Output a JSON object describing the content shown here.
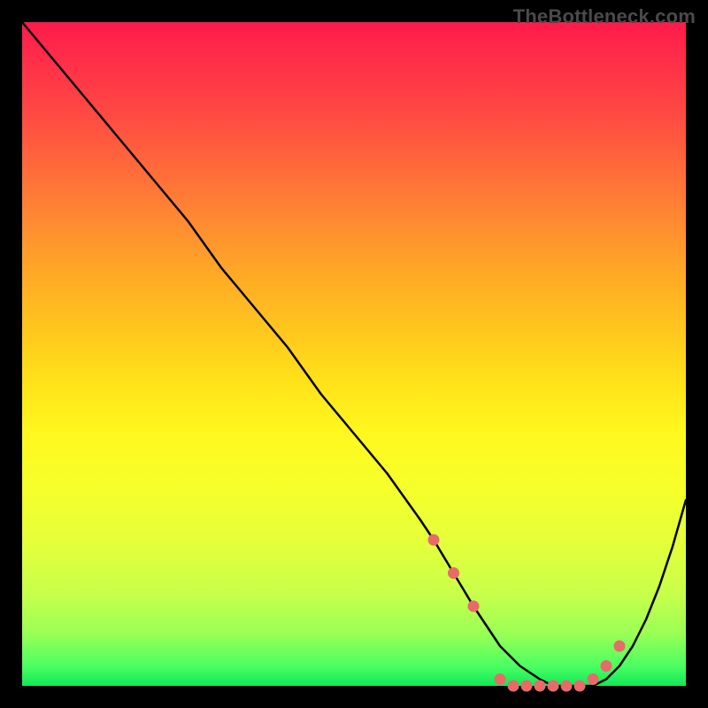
{
  "watermark": "TheBottleneck.com",
  "chart_data": {
    "type": "line",
    "title": "",
    "xlabel": "",
    "ylabel": "",
    "xlim": [
      0,
      100
    ],
    "ylim": [
      0,
      100
    ],
    "grid": false,
    "legend": false,
    "series": [
      {
        "name": "bottleneck-curve",
        "x": [
          0,
          5,
          10,
          15,
          20,
          25,
          30,
          35,
          40,
          45,
          50,
          55,
          60,
          62,
          65,
          68,
          70,
          72,
          75,
          78,
          80,
          82,
          84,
          86,
          88,
          90,
          92,
          94,
          96,
          98,
          100
        ],
        "y": [
          100,
          94,
          88,
          82,
          76,
          70,
          63,
          57,
          51,
          44,
          38,
          32,
          25,
          22,
          17,
          12,
          9,
          6,
          3,
          1,
          0,
          0,
          0,
          0,
          1,
          3,
          6,
          10,
          15,
          21,
          28
        ]
      }
    ],
    "markers": {
      "name": "highlight-dots",
      "x": [
        62,
        65,
        68,
        72,
        74,
        76,
        78,
        80,
        82,
        84,
        86,
        88,
        90
      ],
      "y": [
        22,
        17,
        12,
        1,
        0,
        0,
        0,
        0,
        0,
        0,
        1,
        3,
        6
      ]
    },
    "background_gradient": {
      "top": "#ff1a4b",
      "bottom": "#10e858"
    }
  }
}
